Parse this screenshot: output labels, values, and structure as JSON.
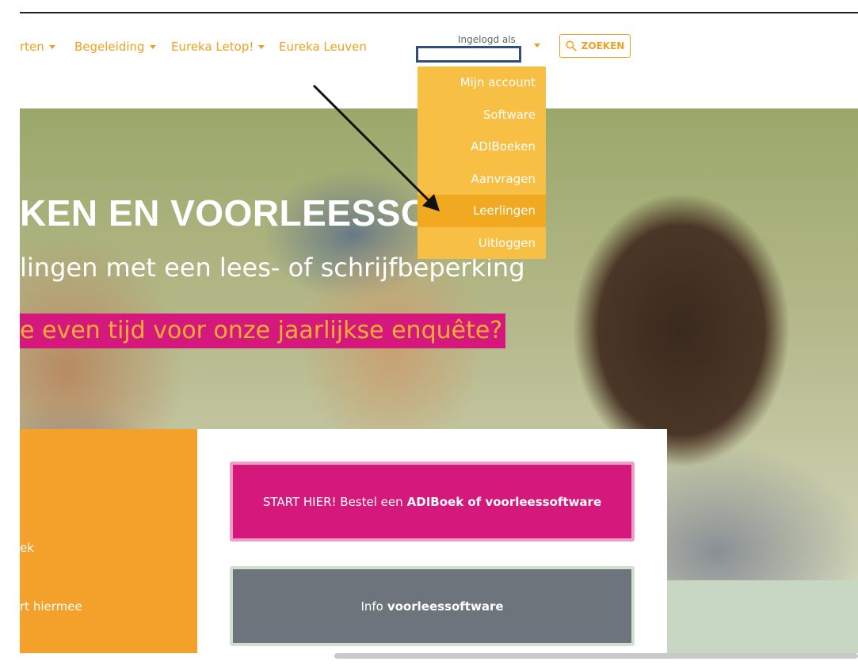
{
  "nav": {
    "items": [
      {
        "label": "rten",
        "has_caret": true
      },
      {
        "label": "Begeleiding",
        "has_caret": true
      },
      {
        "label": "Eureka Letop!",
        "has_caret": true
      },
      {
        "label": "Eureka Leuven",
        "has_caret": false
      }
    ],
    "login_label": "Ingelogd als",
    "search_label": "ZOEKEN"
  },
  "dropdown": {
    "items": [
      {
        "label": "Mijn account"
      },
      {
        "label": "Software"
      },
      {
        "label": "ADIBoeken"
      },
      {
        "label": "Aanvragen"
      },
      {
        "label": "Leerlingen",
        "active": true
      },
      {
        "label": "Uitloggen"
      }
    ]
  },
  "hero": {
    "title": "KEN EN VOORLEESSOFTW",
    "subtitle": "lingen met een lees- of schrijfbeperking",
    "banner": "e even tijd voor onze jaarlijkse enquête?"
  },
  "orange_panel": {
    "line1": "ek",
    "line2": "rt hiermee"
  },
  "buttons": {
    "start_prefix": "START HIER! Bestel een",
    "start_bold": "ADIBoek of voorleessoftware",
    "info_prefix": "Info",
    "info_bold": "voorleessoftware"
  },
  "colors": {
    "accent_orange": "#f0a020",
    "dropdown_bg": "#f8bf45",
    "dropdown_active": "#f1a922",
    "magenta": "#d4187c",
    "gray_button": "#6d747b"
  }
}
